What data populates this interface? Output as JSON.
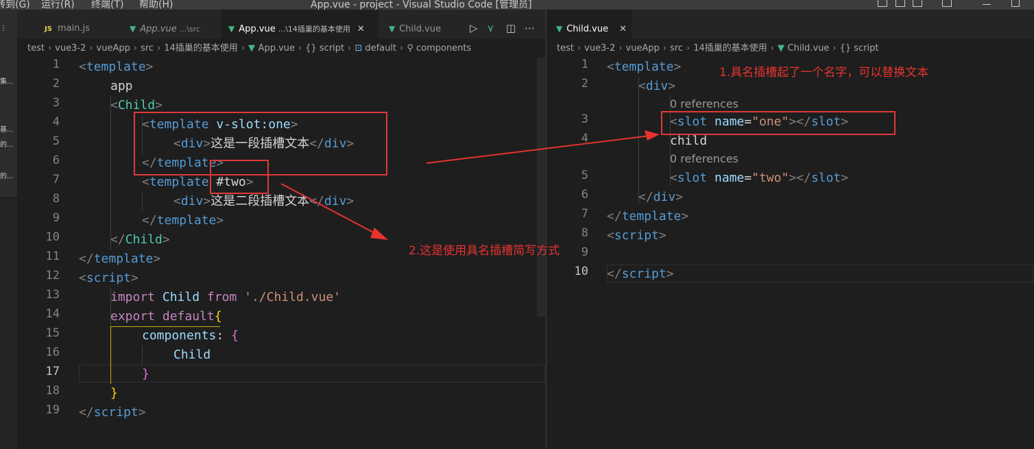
{
  "titlebar": {
    "menus": [
      "转到(G)",
      "运行(R)",
      "终端(T)",
      "帮助(H)"
    ],
    "title": "App.vue - project - Visual Studio Code [管理员]"
  },
  "sidebar_fragments": [
    "集...",
    "基...",
    "的...",
    "的..."
  ],
  "left_group": {
    "tabs": [
      {
        "label": "main.js",
        "icon": "js-icon"
      },
      {
        "label": "App.vue",
        "desc": "...\\src",
        "icon": "vue-icon"
      },
      {
        "label": "App.vue",
        "desc": "...\\14插巢的基本使用",
        "icon": "vue-icon",
        "active": true
      },
      {
        "label": "Child.vue",
        "icon": "vue-icon"
      }
    ],
    "breadcrumb": [
      "test",
      "vue3-2",
      "vueApp",
      "src",
      "14插巢的基本使用",
      "App.vue",
      "{} script",
      "default",
      "components"
    ],
    "line_numbers": [
      "1",
      "2",
      "3",
      "4",
      "5",
      "6",
      "7",
      "8",
      "9",
      "10",
      "11",
      "12",
      "13",
      "14",
      "15",
      "16",
      "17",
      "18",
      "19"
    ],
    "current_line": "17"
  },
  "right_group": {
    "tabs": [
      {
        "label": "Child.vue",
        "icon": "vue-icon",
        "active": true
      }
    ],
    "breadcrumb": [
      "test",
      "vue3-2",
      "vueApp",
      "src",
      "14插巢的基本使用",
      "Child.vue",
      "{} script"
    ],
    "line_numbers": [
      "1",
      "2",
      "3",
      "4",
      "5",
      "6",
      "7",
      "8",
      "9",
      "10"
    ],
    "codelens": "0 references"
  },
  "annotations": {
    "note1": "1.具名插槽起了一个名字，可以替换文本",
    "note2": "2.这是使用具名插槽简写方式"
  },
  "colors": {
    "annotation_red": "#e8332f",
    "vue_green": "#41b883",
    "editor_bg": "#1e1e1e"
  }
}
